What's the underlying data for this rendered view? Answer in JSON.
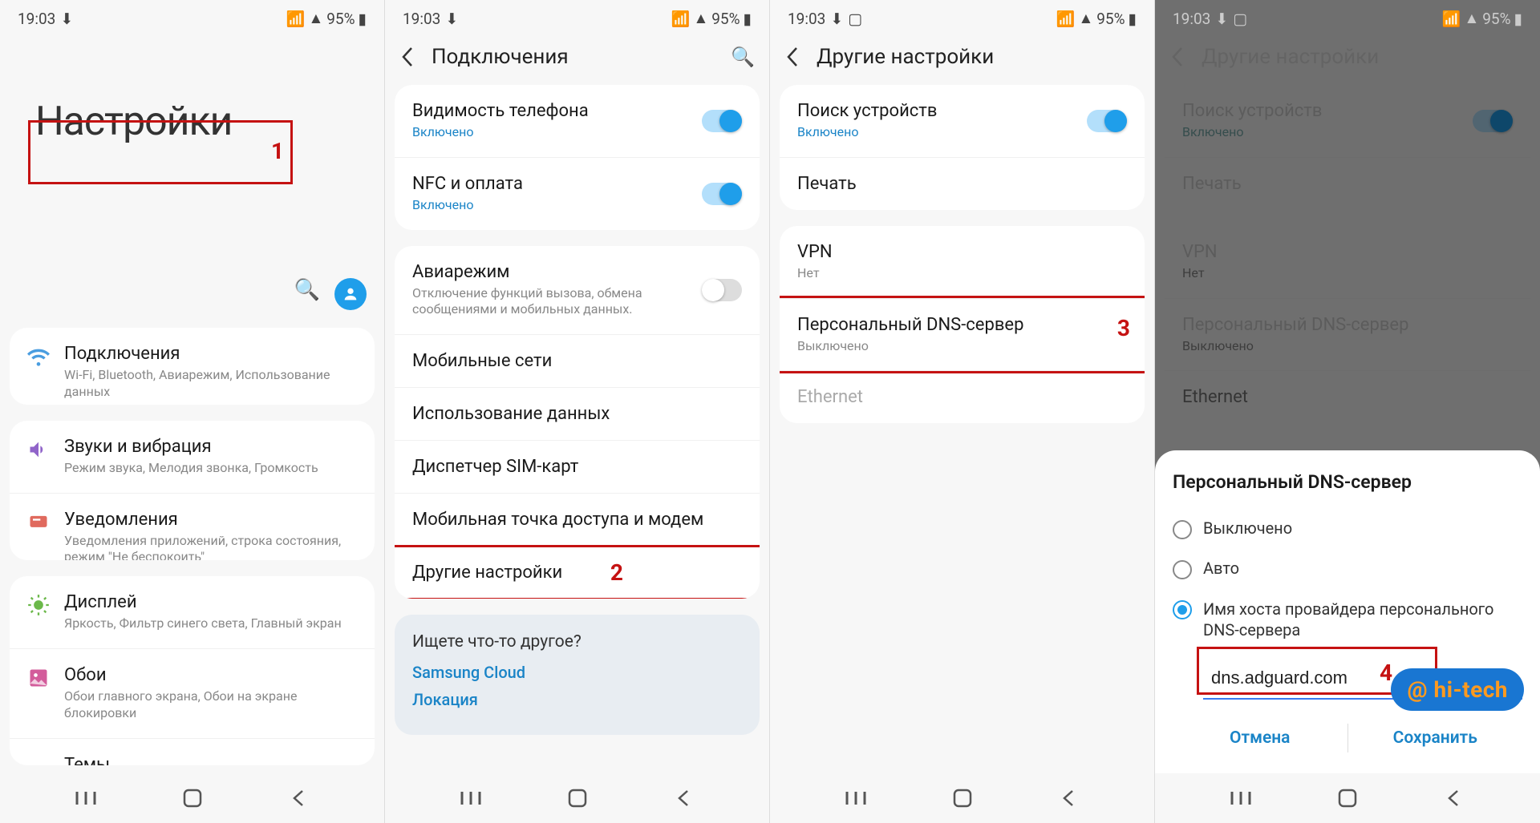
{
  "status": {
    "time": "19:03",
    "battery": "95%"
  },
  "nav_icons": {
    "recents": "|||",
    "home": "○",
    "back": "<"
  },
  "screen1": {
    "big_title": "Настройки",
    "step_num": "1",
    "items": [
      {
        "icon": "wifi-icon",
        "title": "Подключения",
        "sub": "Wi-Fi, Bluetooth, Авиарежим, Использование данных"
      },
      {
        "icon": "sound-icon",
        "title": "Звуки и вибрация",
        "sub": "Режим звука, Мелодия звонка, Громкость"
      },
      {
        "icon": "notification-icon",
        "title": "Уведомления",
        "sub": "Уведомления приложений, строка состояния, режим \"Не беспокоить\""
      },
      {
        "icon": "display-icon",
        "title": "Дисплей",
        "sub": "Яркость, Фильтр синего света, Главный экран"
      },
      {
        "icon": "wallpaper-icon",
        "title": "Обои",
        "sub": "Обои главного экрана, Обои на экране блокировки"
      },
      {
        "icon": "themes-icon",
        "title": "Темы",
        "sub": ""
      }
    ]
  },
  "screen2": {
    "title": "Подключения",
    "step_num": "2",
    "items_a": [
      {
        "title": "Видимость телефона",
        "sub": "Включено",
        "sub_on": true,
        "switch": "on"
      },
      {
        "title": "NFC и оплата",
        "sub": "Включено",
        "sub_on": true,
        "switch": "on"
      }
    ],
    "items_b": [
      {
        "title": "Авиарежим",
        "sub": "Отключение функций вызова, обмена сообщениями и мобильных данных.",
        "switch": "off"
      },
      {
        "title": "Мобильные сети"
      },
      {
        "title": "Использование данных"
      },
      {
        "title": "Диспетчер SIM-карт"
      },
      {
        "title": "Мобильная точка доступа и модем"
      },
      {
        "title": "Другие настройки"
      }
    ],
    "hint": {
      "title": "Ищете что-то другое?",
      "link1": "Samsung Cloud",
      "link2": "Локация"
    }
  },
  "screen3": {
    "title": "Другие настройки",
    "step_num": "3",
    "items_a": [
      {
        "title": "Поиск устройств",
        "sub": "Включено",
        "sub_on": true,
        "switch": "on"
      },
      {
        "title": "Печать"
      }
    ],
    "items_b": [
      {
        "title": "VPN",
        "sub": "Нет"
      },
      {
        "title": "Персональный DNS-сервер",
        "sub": "Выключено"
      },
      {
        "title": "Ethernet",
        "disabled": true
      }
    ]
  },
  "screen4": {
    "title": "Другие настройки",
    "step_num": "4",
    "items_a": [
      {
        "title": "Поиск устройств",
        "sub": "Включено",
        "switch": "on"
      },
      {
        "title": "Печать"
      }
    ],
    "items_b": [
      {
        "title": "VPN",
        "sub": "Нет"
      },
      {
        "title": "Персональный DNS-сервер",
        "sub": "Выключено"
      },
      {
        "title": "Ethernet",
        "disabled": true
      }
    ],
    "dialog": {
      "title": "Персональный DNS-сервер",
      "opt_off": "Выключено",
      "opt_auto": "Авто",
      "opt_host": "Имя хоста провайдера персонального DNS-сервера",
      "host_value": "dns.adguard.com",
      "cancel": "Отмена",
      "save": "Сохранить"
    }
  },
  "watermark": "@ hi-tech"
}
